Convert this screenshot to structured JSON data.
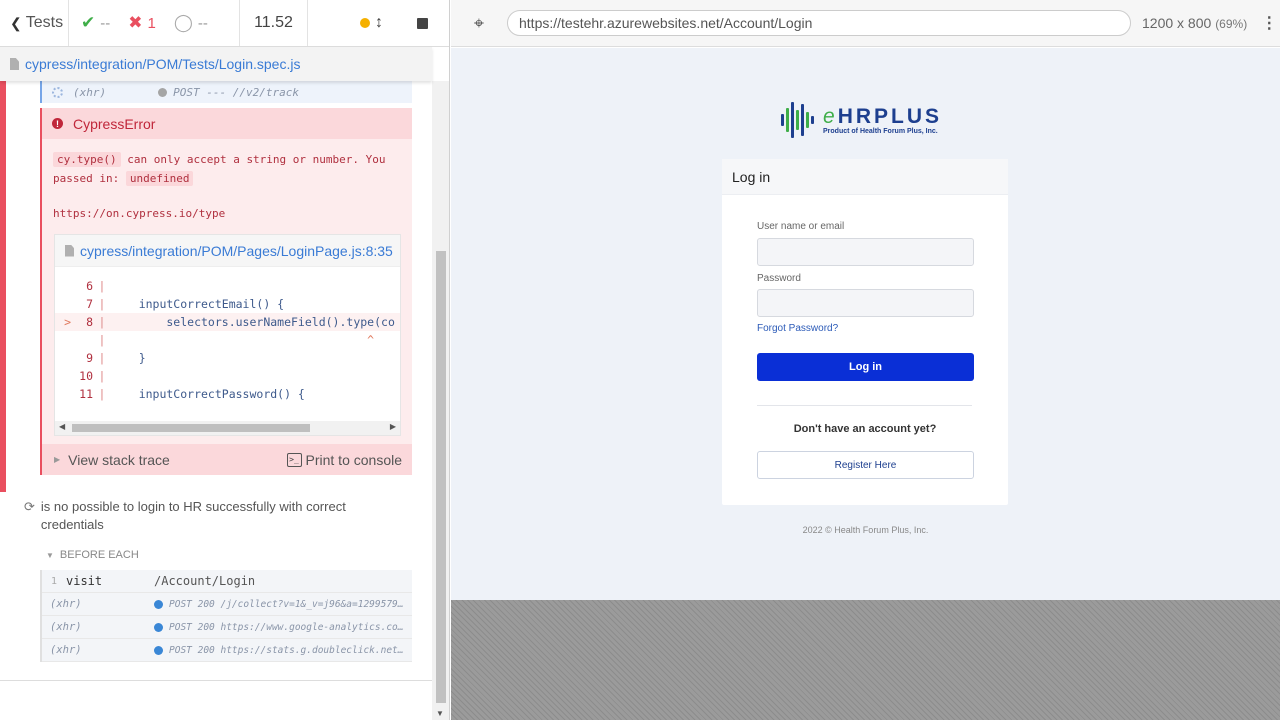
{
  "reporter": {
    "back_label": "Tests",
    "passed_count": "--",
    "failed_count": "1",
    "pending_count": "--",
    "duration": "11.52",
    "spec_path": "cypress/integration/POM/Tests/Login.spec.js",
    "xhr_top": {
      "type": "(xhr)",
      "message": "POST --- //v2/track"
    },
    "error": {
      "title": "CypressError",
      "code_chip": "cy.type()",
      "message_part": " can only accept a string or number. You passed in: ",
      "value_chip": "undefined",
      "docs_link": "https://on.cypress.io/type",
      "code_file": "cypress/integration/POM/Pages/LoginPage.js:8:35",
      "code_lines": [
        {
          "num": "6",
          "text": "",
          "mark": ""
        },
        {
          "num": "7",
          "text": "    inputCorrectEmail() {",
          "mark": ""
        },
        {
          "num": "8",
          "text": "        selectors.userNameField().type(co",
          "mark": ">"
        },
        {
          "num": "",
          "text": "                                     ^",
          "mark": ""
        },
        {
          "num": "9",
          "text": "    }",
          "mark": ""
        },
        {
          "num": "10",
          "text": "",
          "mark": ""
        },
        {
          "num": "11",
          "text": "    inputCorrectPassword() {",
          "mark": ""
        }
      ],
      "stack_label": "View stack trace",
      "print_label": "Print to console"
    },
    "test2_title": "is no possible to login to HR successfully with correct credentials",
    "before_each_label": "BEFORE EACH",
    "commands": [
      {
        "num": "1",
        "name": "visit",
        "message": "/Account/Login"
      },
      {
        "name": "(xhr)",
        "message": "POST 200 /j/collect?v=1&_v=j96&a=12995797..."
      },
      {
        "name": "(xhr)",
        "message": "POST 200 https://www.google-analytics.com..."
      },
      {
        "name": "(xhr)",
        "message": "POST 200 https://stats.g.doubleclick.net/..."
      }
    ]
  },
  "aut": {
    "url": "https://testehr.azurewebsites.net/Account/Login",
    "viewport": "1200 x 800",
    "scale": "(69%)",
    "logo_title_e": "e",
    "logo_title_rest": "HRPLUS",
    "logo_subtitle": "Product of Health Forum Plus, Inc.",
    "card_title": "Log in",
    "username_label": "User name or email",
    "password_label": "Password",
    "forgot_link": "Forgot Password?",
    "login_button": "Log in",
    "no_account_text": "Don't have an account yet?",
    "register_button": "Register Here",
    "copyright": "2022 © Health Forum Plus, Inc."
  },
  "colors": {
    "fail": "#e94f5f",
    "link": "#3a7bd5",
    "brand_blue": "#0a2fd6",
    "brand_green": "#3fae49"
  }
}
